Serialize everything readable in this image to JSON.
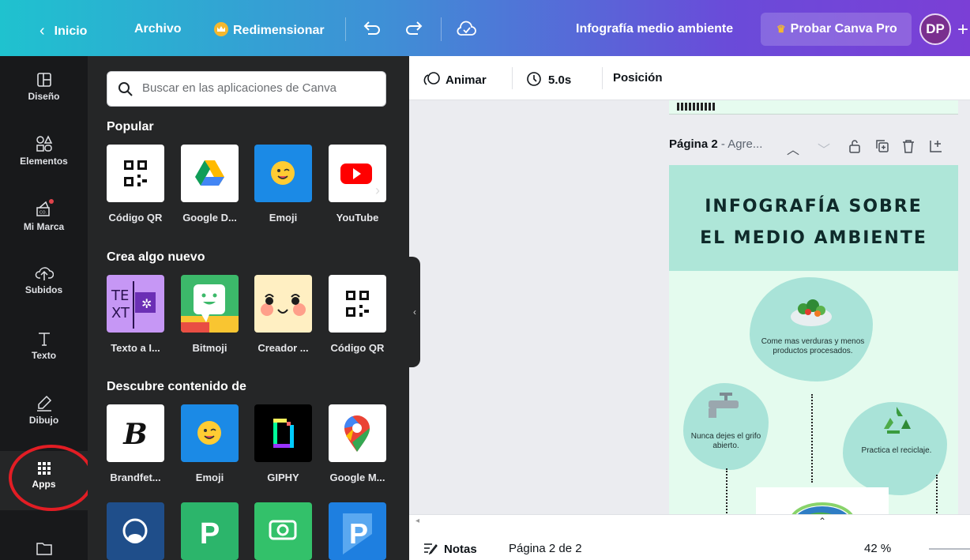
{
  "topbar": {
    "back_label": "Inicio",
    "file_label": "Archivo",
    "resize_label": "Redimensionar",
    "doc_title": "Infografía medio ambiente",
    "pro_label": "Probar Canva Pro",
    "avatar_initials": "DP"
  },
  "rail": {
    "items": [
      {
        "label": "Diseño",
        "icon": "layout-icon"
      },
      {
        "label": "Elementos",
        "icon": "shapes-icon"
      },
      {
        "label": "Mi Marca",
        "icon": "brand-icon"
      },
      {
        "label": "Subidos",
        "icon": "cloud-upload-icon"
      },
      {
        "label": "Texto",
        "icon": "text-icon"
      },
      {
        "label": "Dibujo",
        "icon": "draw-icon"
      },
      {
        "label": "Apps",
        "icon": "apps-grid-icon"
      }
    ]
  },
  "panel": {
    "search_placeholder": "Buscar en las aplicaciones de Canva",
    "sections": [
      {
        "title": "Popular",
        "apps": [
          "Código QR",
          "Google D...",
          "Emoji",
          "YouTube"
        ]
      },
      {
        "title": "Crea algo nuevo",
        "apps": [
          "Texto a I...",
          "Bitmoji",
          "Creador ...",
          "Código QR"
        ]
      },
      {
        "title": "Descubre contenido de",
        "apps": [
          "Brandfet...",
          "Emoji",
          "GIPHY",
          "Google M..."
        ]
      }
    ]
  },
  "editor": {
    "animate_label": "Animar",
    "duration_label": "5.0s",
    "position_label": "Posición",
    "page_header_bold": "Página 2",
    "page_header_rest": " - Agre...",
    "design": {
      "title_line1": "INFOGRAFÍA SOBRE",
      "title_line2": "EL MEDIO AMBIENTE",
      "tip1": "Come mas verduras y menos productos procesados.",
      "tip2": "Nunca dejes el grifo abierto.",
      "tip3": "Practica el reciclaje."
    },
    "notes_label": "Notas",
    "page_count": "Página 2 de 2",
    "zoom": "42 %"
  },
  "colors": {
    "accent_red_circle": "#e21d24",
    "panel_bg": "#252627",
    "rail_bg": "#18191b"
  }
}
